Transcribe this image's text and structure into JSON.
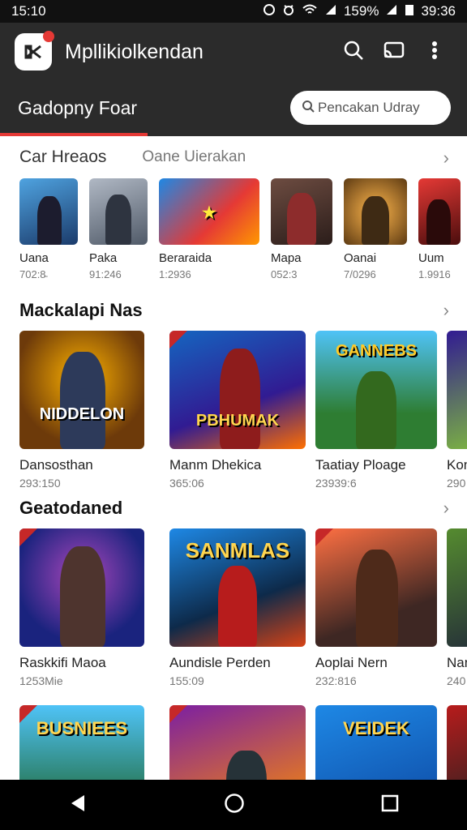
{
  "status_bar": {
    "time": "15:10",
    "battery": "159%",
    "clock_right": "39:36"
  },
  "app_bar": {
    "title": "Mpllikiolkendan"
  },
  "tab": {
    "label": "Gadopny Foar"
  },
  "search": {
    "placeholder": "Pencakan Udray"
  },
  "sections": [
    {
      "title": "Car Hreaos",
      "subtitle": "Oane Uierakan",
      "items": [
        {
          "name": "Uana",
          "count": "702:8̵"
        },
        {
          "name": "Paka",
          "count": "91:246"
        },
        {
          "name": "Beraraida",
          "count": "1:2936"
        },
        {
          "name": "Mapa",
          "count": "052:3"
        },
        {
          "name": "Oanai",
          "count": "7/0296"
        },
        {
          "name": "Uum",
          "count": "1.9916"
        }
      ]
    },
    {
      "title": "Mackalapi Nas",
      "items": [
        {
          "name": "Dansosthan",
          "count": "293:150",
          "art": "NIDDELON"
        },
        {
          "name": "Manm Dhekica",
          "count": "365:06",
          "art": "PBHUMAK"
        },
        {
          "name": "Taatiay Ploage",
          "count": "23939:6",
          "art": "GANNEBS"
        },
        {
          "name": "Kon",
          "count": "290",
          "art": ""
        }
      ]
    },
    {
      "title": "Geatodaned",
      "items": [
        {
          "name": "Raskkifi Maoa",
          "count": "1253Mie",
          "art": ""
        },
        {
          "name": "Aundisle Perden",
          "count": "155:09",
          "art": "SANMLAS"
        },
        {
          "name": "Aoplai Nern",
          "count": "232:816",
          "art": ""
        },
        {
          "name": "Nan",
          "count": "240",
          "art": ""
        }
      ]
    },
    {
      "title": "",
      "items": [
        {
          "name": "",
          "count": "",
          "art": "BUSNIEES"
        },
        {
          "name": "",
          "count": "",
          "art": ""
        },
        {
          "name": "",
          "count": "",
          "art": "VEIDEK"
        },
        {
          "name": "",
          "count": "",
          "art": ""
        }
      ]
    }
  ],
  "icons": {
    "app_logo": "game-logo-icon",
    "search": "search-icon",
    "cast": "cast-icon",
    "more": "more-vert-icon",
    "back": "back-icon",
    "home": "home-icon",
    "recents": "recents-icon"
  },
  "colors": {
    "accent": "#e53935",
    "appbar": "#2b2b2b"
  }
}
